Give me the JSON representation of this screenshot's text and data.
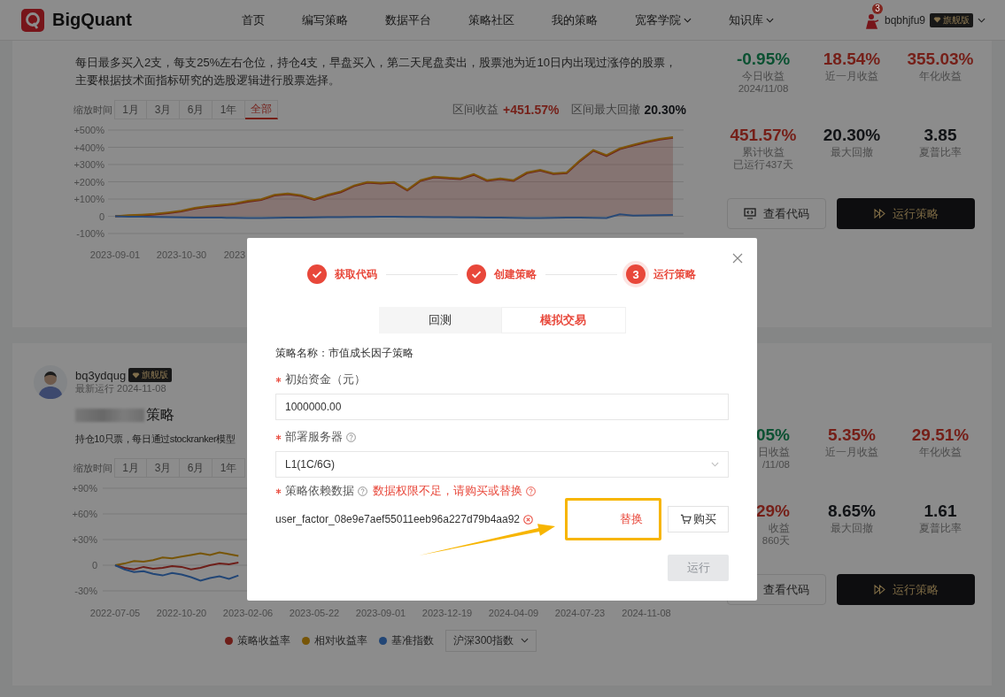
{
  "header": {
    "brand": "BigQuant",
    "nav": [
      {
        "label": "首页",
        "dropdown": false
      },
      {
        "label": "编写策略",
        "dropdown": false
      },
      {
        "label": "数据平台",
        "dropdown": false
      },
      {
        "label": "策略社区",
        "dropdown": false
      },
      {
        "label": "我的策略",
        "dropdown": false
      },
      {
        "label": "宽客学院",
        "dropdown": true
      },
      {
        "label": "知识库",
        "dropdown": true
      }
    ],
    "user": {
      "notifications": "3",
      "name": "bqbhjfu9",
      "badge": "旗舰版"
    }
  },
  "strategies": [
    {
      "description": "每日最多买入2支，每支25%左右仓位，持仓4支，早盘买入，第二天尾盘卖出，股票池为近10日内出现过涨停的股票，主要根据技术面指标研究的选股逻辑进行股票选择。",
      "zoom": {
        "label": "缩放时间",
        "options": [
          {
            "label": "1月",
            "selected": false
          },
          {
            "label": "3月",
            "selected": false
          },
          {
            "label": "6月",
            "selected": false
          },
          {
            "label": "1年",
            "selected": false
          },
          {
            "label": "全部",
            "selected": true
          }
        ]
      },
      "summary": [
        {
          "label": "区间收益",
          "value": "+451.57%",
          "color": "#751f18"
        },
        {
          "label": "区间最大回撤",
          "value": "20.30%",
          "color": "#111316"
        }
      ],
      "chart_data": {
        "type": "line",
        "grid": true,
        "categories": [
          "2023-09-01",
          null,
          null,
          null,
          null,
          "2023-10-30",
          null,
          null,
          null,
          "2023",
          null,
          null,
          null,
          null,
          null,
          null,
          null,
          null,
          null,
          null,
          null,
          null,
          null,
          null,
          null,
          null,
          null,
          null,
          null,
          null,
          null,
          null,
          null,
          null,
          null,
          null,
          null,
          null,
          null,
          null,
          null,
          null,
          null
        ],
        "ylim": [
          -100,
          500
        ],
        "yticks": [
          {
            "value": 500,
            "label": "+500%"
          },
          {
            "value": 400,
            "label": "+400%"
          },
          {
            "value": 300,
            "label": "+300%"
          },
          {
            "value": 200,
            "label": "+200%"
          },
          {
            "value": 100,
            "label": "+100%"
          },
          {
            "value": 0,
            "label": "0"
          },
          {
            "value": -100,
            "label": "-100%"
          }
        ],
        "series": [
          {
            "color": "#6e1e19",
            "values": [
              0,
              2,
              5,
              10,
              18,
              28,
              45,
              55,
              62,
              70,
              85,
              95,
              120,
              128,
              118,
              95,
              120,
              140,
              175,
              195,
              190,
              195,
              150,
              205,
              225,
              220,
              215,
              240,
              205,
              215,
              205,
              250,
              265,
              245,
              250,
              320,
              380,
              350,
              390,
              410,
              430,
              445,
              455
            ]
          },
          {
            "color": "#7d550b",
            "values": [
              0,
              6,
              9,
              14,
              22,
              32,
              49,
              59,
              66,
              74,
              89,
              99,
              124,
              132,
              122,
              99,
              124,
              144,
              179,
              199,
              194,
              199,
              154,
              209,
              229,
              224,
              219,
              244,
              209,
              219,
              209,
              254,
              269,
              249,
              254,
              324,
              384,
              354,
              394,
              414,
              434,
              449,
              459
            ]
          },
          {
            "color": "#294a77",
            "values": [
              0,
              -2,
              -3,
              -4,
              -5,
              -6,
              -7,
              -8,
              -8,
              -9,
              -10,
              -10,
              -9,
              -8,
              -7,
              -6,
              -5,
              -5,
              -4,
              -4,
              -3,
              -3,
              -4,
              -4,
              -5,
              -5,
              -6,
              -6,
              -7,
              -8,
              -9,
              -10,
              -10,
              -9,
              -8,
              -8,
              -9,
              -10,
              12,
              4,
              5,
              6,
              8
            ]
          }
        ]
      },
      "stats": [
        {
          "value": "-0.95%",
          "label": "今日收益",
          "sub": "2024/11/08",
          "color": "#0b5132"
        },
        {
          "value": "18.54%",
          "label": "近一月收益",
          "color": "#751f18"
        },
        {
          "value": "355.03%",
          "label": "年化收益",
          "color": "#751f18"
        },
        {
          "value": "451.57%",
          "label": "累计收益",
          "sub": "已运行437天",
          "color": "#751f18"
        },
        {
          "value": "20.30%",
          "label": "最大回撤",
          "color": "#111316"
        },
        {
          "value": "3.85",
          "label": "夏普比率",
          "color": "#111316"
        }
      ],
      "actions": [
        {
          "kind": "outline",
          "label": "查看代码"
        },
        {
          "kind": "primary",
          "label": "运行策略"
        }
      ]
    },
    {
      "author": {
        "name": "bq3ydqug",
        "badge": "旗舰版",
        "last_run": "最新运行 2024-11-08"
      },
      "title": "策略",
      "description": "持仓10只票，每日通过stockranker模型",
      "zoom": {
        "label": "缩放时间",
        "options": [
          {
            "label": "1月",
            "selected": false
          },
          {
            "label": "3月",
            "selected": false
          },
          {
            "label": "6月",
            "selected": false
          },
          {
            "label": "1年",
            "selected": false
          }
        ]
      },
      "chart_data": {
        "type": "line",
        "grid": true,
        "categories": [
          "2022-07-05",
          null,
          null,
          null,
          null,
          null,
          null,
          "2022-10-20",
          null,
          null,
          null,
          null,
          null,
          null,
          "2023-02-06",
          null,
          null,
          null,
          null,
          null,
          null,
          "2023-05-22",
          null,
          null,
          null,
          null,
          null,
          null,
          "2023-09-01",
          null,
          null,
          null,
          null,
          null,
          null,
          "2023-12-19",
          null,
          null,
          null,
          null,
          null,
          null,
          "2024-04-09",
          null,
          null,
          null,
          null,
          null,
          null,
          "2024-07-23",
          null,
          null,
          null,
          null,
          null,
          null,
          "2024-11-08"
        ],
        "ylim": [
          -30,
          90
        ],
        "yticks": [
          {
            "value": 90,
            "label": "+90%"
          },
          {
            "value": 60,
            "label": "+60%"
          },
          {
            "value": 30,
            "label": "+30%"
          },
          {
            "value": 0,
            "label": "0"
          },
          {
            "value": -30,
            "label": "-30%"
          }
        ],
        "series": [
          {
            "name": "策略收益率",
            "color": "#6e1e19",
            "values": [
              0,
              -3,
              -5,
              -2,
              -4,
              -3,
              -1,
              -2,
              -5,
              -3,
              0,
              2,
              1,
              3,
              null,
              null,
              null,
              null,
              null,
              null,
              null,
              null,
              null,
              null,
              null,
              null,
              null,
              null,
              null,
              null,
              null,
              null,
              null,
              null,
              null,
              null,
              null,
              null,
              null,
              null,
              null,
              null,
              null,
              null,
              null,
              null,
              null,
              null,
              null,
              null,
              null,
              null,
              null,
              null,
              null,
              null,
              null
            ]
          },
          {
            "name": "相对收益率",
            "color": "#775507",
            "values": [
              0,
              2,
              5,
              4,
              6,
              9,
              8,
              10,
              12,
              14,
              12,
              15,
              13,
              11,
              null,
              null,
              null,
              null,
              null,
              null,
              null,
              null,
              null,
              null,
              null,
              null,
              null,
              null,
              null,
              null,
              null,
              null,
              null,
              null,
              null,
              null,
              null,
              null,
              null,
              null,
              null,
              null,
              null,
              null,
              null,
              null,
              null,
              null,
              null,
              null,
              null,
              null,
              null,
              null,
              null,
              null,
              null
            ]
          },
          {
            "name": "基准指数",
            "color": "#224676",
            "values": [
              0,
              -5,
              -8,
              -7,
              -10,
              -12,
              -9,
              -11,
              -14,
              -18,
              -15,
              -13,
              -16,
              -12,
              null,
              null,
              null,
              null,
              null,
              null,
              null,
              null,
              null,
              null,
              null,
              null,
              null,
              null,
              null,
              null,
              null,
              null,
              null,
              null,
              null,
              null,
              null,
              null,
              null,
              null,
              null,
              null,
              null,
              null,
              null,
              null,
              null,
              null,
              null,
              null,
              null,
              null,
              null,
              null,
              null,
              null,
              null
            ]
          }
        ]
      },
      "benchmark": "沪深300指数",
      "stats": [
        {
          "value": "05%",
          "label": "日收益",
          "sub": "/11/08",
          "color": "#0b5132"
        },
        {
          "value": "5.35%",
          "label": "近一月收益",
          "color": "#751f18"
        },
        {
          "value": "29.51%",
          "label": "年化收益",
          "color": "#751f18"
        },
        {
          "value": "29%",
          "label": "收益",
          "sub": "860天",
          "color": "#751f18"
        },
        {
          "value": "8.65%",
          "label": "最大回撤",
          "color": "#111316"
        },
        {
          "value": "1.61",
          "label": "夏普比率",
          "color": "#111316"
        }
      ],
      "actions": [
        {
          "kind": "outline",
          "label": "查看代码"
        },
        {
          "kind": "primary",
          "label": "运行策略"
        }
      ]
    }
  ],
  "dialog": {
    "steps": [
      {
        "label": "获取代码",
        "done": true,
        "active": false
      },
      {
        "label": "创建策略",
        "done": true,
        "active": false
      },
      {
        "label": "运行策略",
        "done": false,
        "active": true,
        "number": "3"
      }
    ],
    "tabs": [
      {
        "label": "回测",
        "selected": false
      },
      {
        "label": "模拟交易",
        "selected": true
      }
    ],
    "strategy_name": "策略名称：市值成长因子策略",
    "fields": [
      {
        "kind": "input",
        "label": "初始资金（元）",
        "required": true,
        "help": false,
        "value": "1000000.00"
      },
      {
        "kind": "select",
        "label": "部署服务器",
        "required": true,
        "help": true,
        "value": "L1(1C/6G)"
      }
    ],
    "dependency": {
      "label": "策略依赖数据",
      "required": true,
      "help": true,
      "warning": "数据权限不足，请购买或替换",
      "item": "user_factor_08e9e7aef55011eeb96a227d79b4aa92",
      "replace": {
        "label": "替换",
        "highlighted": true
      },
      "buy": {
        "label": "购买"
      }
    },
    "run_button": {
      "label": "运行",
      "disabled": true
    }
  }
}
